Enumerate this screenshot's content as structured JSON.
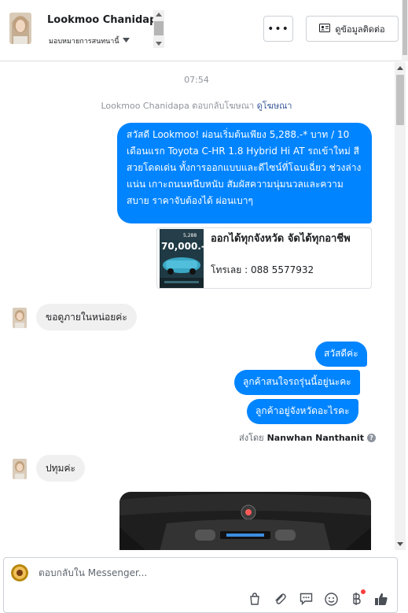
{
  "header": {
    "contact_name": "Lookmoo Chanidapa",
    "assign_label": "มอบหมายการสนทนานี้",
    "more_label": "•••",
    "contact_info_label": "ดูข้อมูลติดต่อ"
  },
  "chat": {
    "timestamp": "07:54",
    "reply_note": "Lookmoo Chanidapa ตอบกลับโฆษณา",
    "reply_link": "ดูโฆษณา",
    "ad_message": "สวัสดี Lookmoo! ผ่อนเริ่มต้นเพียง 5,288.-* บาท / 10 เดือนแรก Toyota C-HR 1.8 Hybrid Hi AT รถเข้าใหม่ สีสวยโดดเด่น ทั้งการออกแบบและดีไซน์ที่โฉบเฉี่ยว ช่วงล่างแน่น เกาะถนนหนึบหนับ สัมผัสความนุ่มนวลและความสบาย ราคาจับต้องได้ ผ่อนเบาๆ",
    "ad_card": {
      "title": "ออกได้ทุกจังหวัด จัดได้ทุกอาชีพ",
      "phone": "โทรเลย : 088 5577932",
      "thumb_text": "70,000.-",
      "thumb_small": "5,288"
    },
    "customer_msg_1": "ขอดูภายในหน่อยค่ะ",
    "agent_msgs": [
      "สวัสดีค่ะ",
      "ลูกค้าสนใจรถรุ่นนี้อยู่นะคะ",
      "ลูกค้าอยู่จังหวัดอะไรคะ"
    ],
    "sent_by_label": "ส่งโดย",
    "sent_by_name": "Nanwhan Nanthanit",
    "customer_msg_2": "ปทุมค่ะ"
  },
  "composer": {
    "placeholder": "ตอบกลับใน Messenger..."
  },
  "icons": {
    "more": "more-icon",
    "contact_card": "contact-card-icon",
    "caret": "caret-down-icon",
    "bag": "bag-icon",
    "attach": "paperclip-icon",
    "saved_reply": "saved-reply-icon",
    "emoji": "emoji-icon",
    "payment": "baht-icon",
    "like": "thumbs-up-icon"
  },
  "colors": {
    "accent": "#0084ff",
    "incoming_bubble": "#f1f0f0",
    "link": "#385898",
    "notification": "#fa3e3e"
  }
}
